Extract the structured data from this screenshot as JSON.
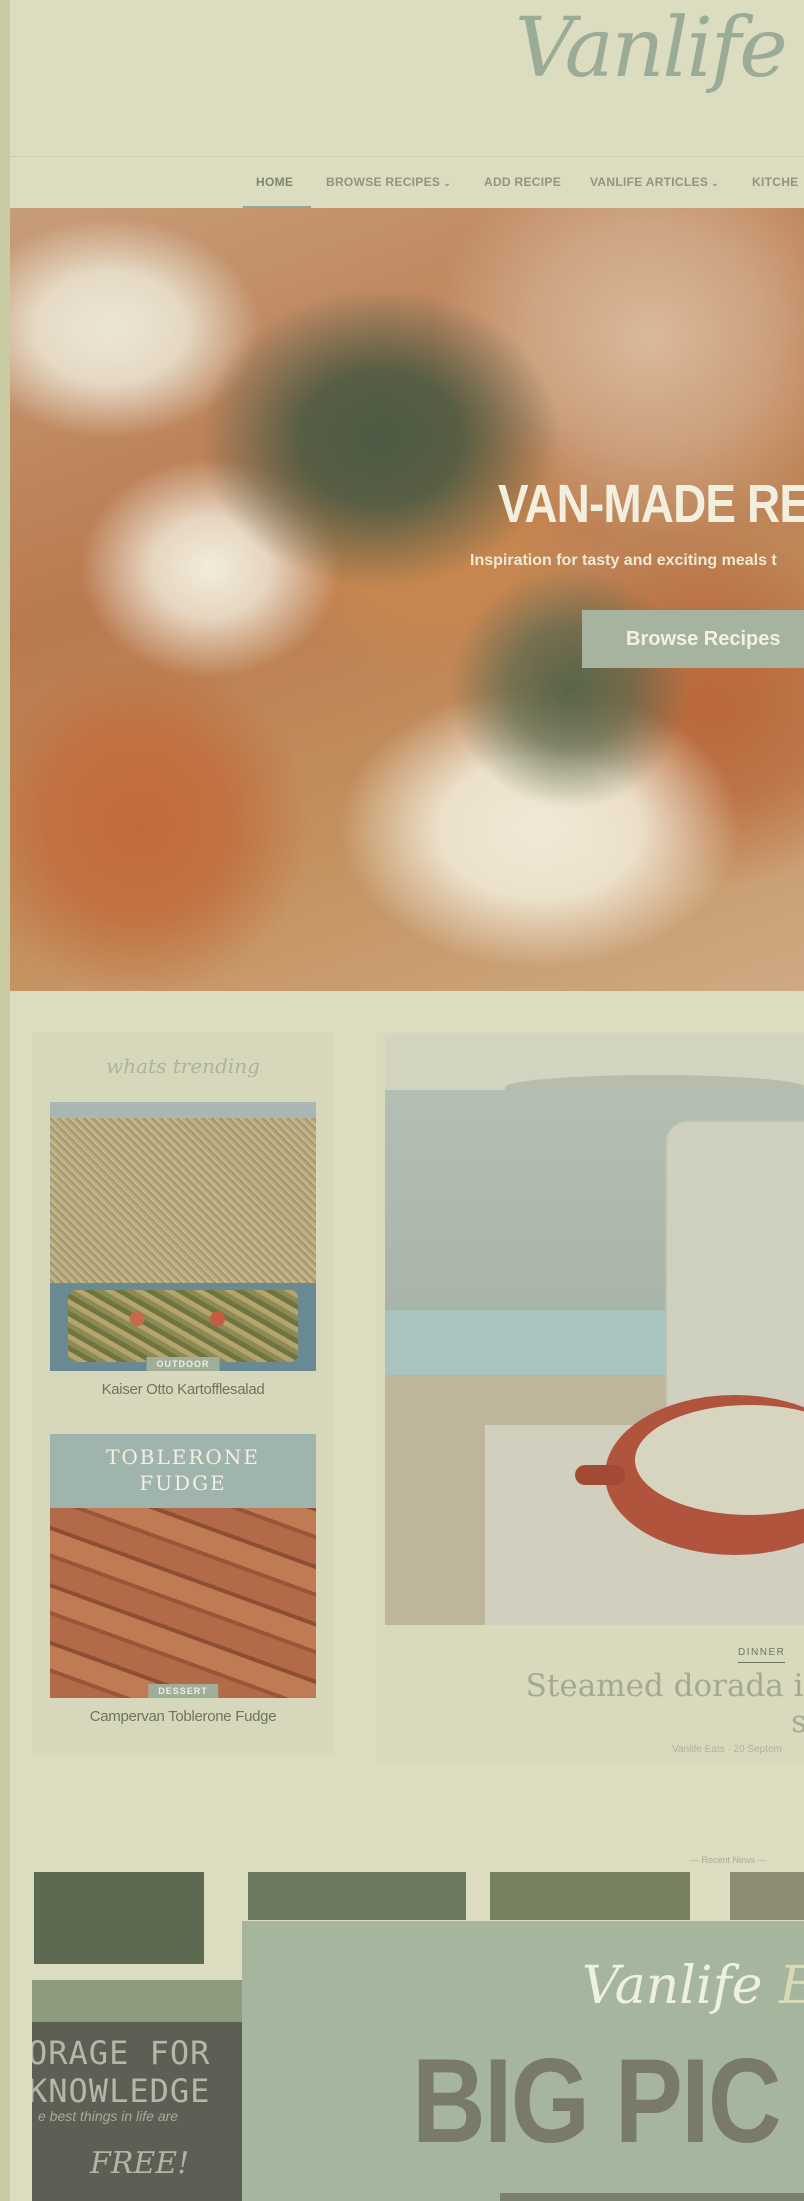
{
  "site": {
    "logo_word1": "Vanlife",
    "logo_word2": "E"
  },
  "nav": {
    "items": [
      {
        "label": "HOME",
        "has_caret": false
      },
      {
        "label": "BROWSE RECIPES",
        "has_caret": true
      },
      {
        "label": "ADD RECIPE",
        "has_caret": false
      },
      {
        "label": "VANLIFE ARTICLES",
        "has_caret": true
      },
      {
        "label": "KITCHE",
        "has_caret": false
      }
    ],
    "caret": "⌄"
  },
  "hero": {
    "title": "VAN-MADE REC",
    "subtitle": "Inspiration for tasty and exciting meals t",
    "button": "Browse Recipes"
  },
  "trending": {
    "title": "whats trending",
    "items": [
      {
        "tag": "OUTDOOR",
        "caption": "Kaiser Otto Kartofflesalad"
      },
      {
        "tag": "DESSERT",
        "caption": "Campervan Toblerone Fudge",
        "image_text": "TOBLERONE\nFUDGE"
      }
    ]
  },
  "featured": {
    "category": "DINNER",
    "title": "Steamed dorada in Pep\nsauce.",
    "meta": "Vanlife Eats  ·  20 Septem"
  },
  "recent": {
    "label": "— Recent News —"
  },
  "chalkboard": {
    "lines": "ORAGE FOR\nKNOWLEDGE",
    "small": "e  best  things  in  life  are",
    "free": "FREE!"
  },
  "promo": {
    "logo_word1": "Vanlife",
    "logo_word2": "Ea",
    "big_text": "BIG PIC"
  }
}
